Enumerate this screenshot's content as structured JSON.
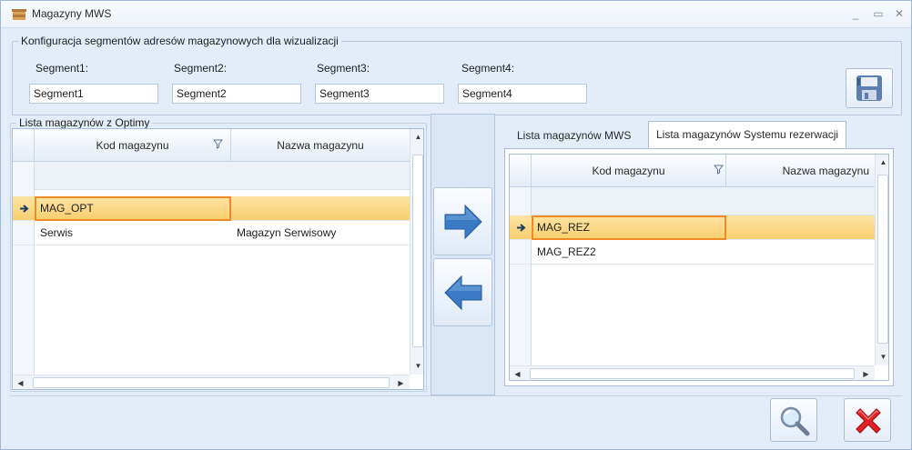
{
  "window": {
    "title": "Magazyny MWS"
  },
  "segments": {
    "group_title": "Konfiguracja segmentów adresów magazynowych dla wizualizacji",
    "fields": [
      {
        "label": "Segment1:",
        "value": "Segment1"
      },
      {
        "label": "Segment2:",
        "value": "Segment2"
      },
      {
        "label": "Segment3:",
        "value": "Segment3"
      },
      {
        "label": "Segment4:",
        "value": "Segment4"
      }
    ]
  },
  "optima": {
    "group_title": "Lista magazynów z Optimy",
    "columns": [
      "Kod magazynu",
      "Nazwa magazynu"
    ],
    "rows": [
      {
        "kod": "MAG_OPT",
        "nazwa": ""
      },
      {
        "kod": "Serwis",
        "nazwa": "Magazyn Serwisowy"
      }
    ]
  },
  "tabs": [
    "Lista magazynów MWS",
    "Lista magazynów Systemu rezerwacji"
  ],
  "reservation": {
    "columns": [
      "Kod magazynu",
      "Nazwa magazynu"
    ],
    "rows": [
      {
        "kod": "MAG_REZ",
        "nazwa": ""
      },
      {
        "kod": "MAG_REZ2",
        "nazwa": ""
      }
    ]
  },
  "icons": {
    "save": "floppy-disk-icon",
    "move_right": "arrow-right-icon",
    "move_left": "arrow-left-icon",
    "search": "magnifier-icon",
    "close": "red-x-icon"
  },
  "colors": {
    "accent_blue": "#3a79c4",
    "selection": "#f9d37a",
    "focus_border": "#f08a24",
    "close_red": "#e02222"
  }
}
